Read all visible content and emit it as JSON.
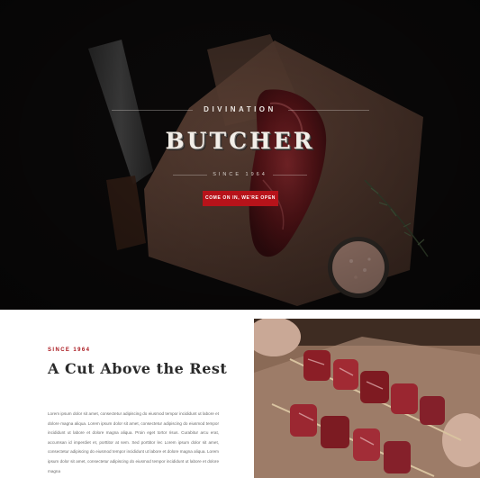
{
  "hero": {
    "eyebrow": "DIVINATION",
    "title": "BUTCHER",
    "since": "SINCE 1964",
    "cta_label": "COME ON IN, WE'RE OPEN"
  },
  "about": {
    "eyebrow": "SINCE 1964",
    "heading": "A Cut Above the Rest",
    "body": "Lorem ipsum dolor sit amet, consectetur adipiscing do eiusmod tempor incididunt ut labore et dolore magna aliqua. Lorem ipsum dolor sit amet, consectetur adipiscing do eiusmod tempor incididunt ut labore et dolore magna aliqua. Proin eget tortor risus. Curabitur arcu erat, accumsan id imperdiet et, porttitor at sem. Sed porttitor lec Lorem ipsum dolor sit amet, consectetur adipiscing do eiusmod tempor incididunt ut labore et dolore magna aliqua. Lorem ipsum dolor sit amet, consectetur adipiscing do eiusmod tempor incididunt ut labore et dolore magna"
  },
  "colors": {
    "accent": "#b7131a",
    "hero_bg": "#0d0b0b",
    "heading": "#2a2a2a"
  }
}
